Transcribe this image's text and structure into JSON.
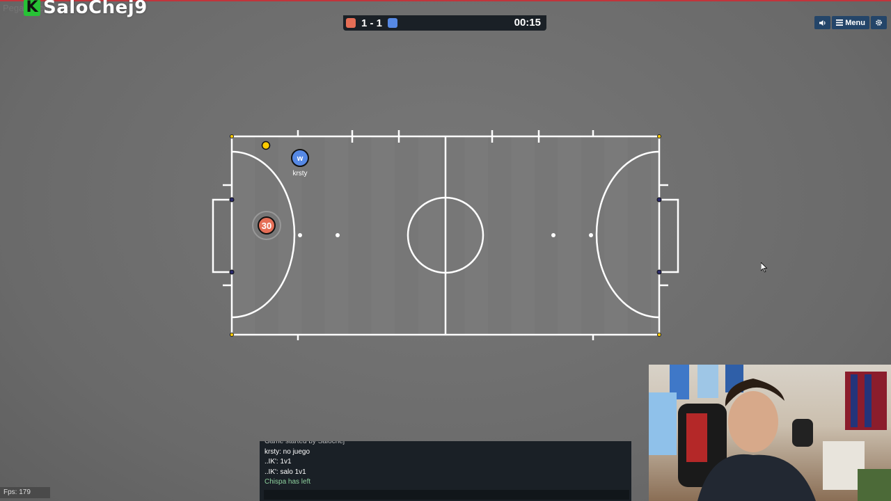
{
  "streamer": {
    "logo_letter": "K",
    "name": "SaloChej9"
  },
  "command": {
    "placeholder": "Pega un comando"
  },
  "scoreboard": {
    "red_color": "#e56e56",
    "blue_color": "#5689e5",
    "score": "1 - 1",
    "time": "00:15"
  },
  "controls": {
    "menu_label": "Menu",
    "sound_icon": "speaker-icon",
    "settings_icon": "gear-icon"
  },
  "players": [
    {
      "team": "blue",
      "avatar": "w",
      "name": "krsty",
      "color": "#5689e5"
    },
    {
      "team": "red",
      "avatar": "30",
      "name": "",
      "color": "#e56e56"
    }
  ],
  "ball": {
    "color": "#ffcc00"
  },
  "chat": {
    "lines": [
      {
        "text": "Game started by Salochej",
        "type": "faded"
      },
      {
        "text": "krsty: no juego",
        "type": "msg"
      },
      {
        "text": "..IK': 1v1",
        "type": "msg"
      },
      {
        "text": "..IK': salo 1v1",
        "type": "msg"
      },
      {
        "text": "Chispa has left",
        "type": "join"
      }
    ]
  },
  "fps": "Fps: 179"
}
